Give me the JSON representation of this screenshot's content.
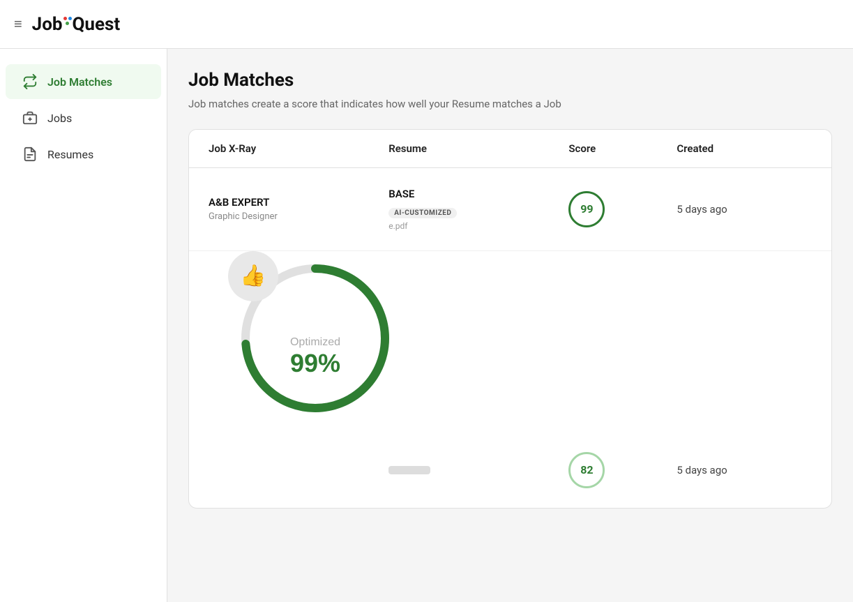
{
  "header": {
    "menu_label": "☰",
    "logo_job": "Job",
    "logo_quest": "Quest"
  },
  "sidebar": {
    "items": [
      {
        "id": "job-matches",
        "label": "Job Matches",
        "icon": "⇌",
        "active": true
      },
      {
        "id": "jobs",
        "label": "Jobs",
        "icon": "💼",
        "active": false
      },
      {
        "id": "resumes",
        "label": "Resumes",
        "icon": "📄",
        "active": false
      }
    ]
  },
  "main": {
    "page_title": "Job Matches",
    "page_subtitle": "Job matches create a score that indicates how well your Resume matches a Job",
    "table": {
      "columns": [
        "Job X-Ray",
        "Resume",
        "Score",
        "Created"
      ],
      "rows": [
        {
          "job_title": "A&B EXPERT",
          "job_subtitle": "Graphic Designer",
          "resume_name": "BASE",
          "resume_badge": "AI-CUSTOMIZED",
          "resume_file": "e.pdf",
          "score": 99,
          "score_type": "high",
          "created": "5 days ago"
        },
        {
          "job_title": "",
          "job_subtitle": "",
          "resume_name": "",
          "resume_badge": "",
          "resume_file": "",
          "score": 82,
          "score_type": "medium",
          "created": "5 days ago"
        }
      ]
    },
    "optimized": {
      "label": "Optimized",
      "percent": "99%",
      "thumb_icon": "👍"
    }
  }
}
